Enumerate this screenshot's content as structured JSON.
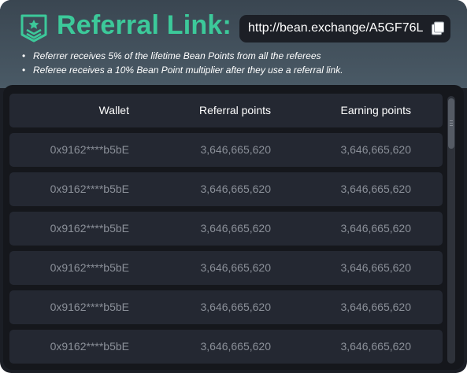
{
  "header": {
    "title": "Referral Link:",
    "link": "http://bean.exchange/A5GF76L",
    "notes": [
      "Referrer receives 5% of the lifetime Bean Points from all the referees",
      "Referee receives a 10% Bean Point multiplier after they use a referral link."
    ]
  },
  "table": {
    "columns": [
      "Wallet",
      "Referral points",
      "Earning  points"
    ],
    "rows": [
      [
        "0x9162****b5bE",
        "3,646,665,620",
        "3,646,665,620"
      ],
      [
        "0x9162****b5bE",
        "3,646,665,620",
        "3,646,665,620"
      ],
      [
        "0x9162****b5bE",
        "3,646,665,620",
        "3,646,665,620"
      ],
      [
        "0x9162****b5bE",
        "3,646,665,620",
        "3,646,665,620"
      ],
      [
        "0x9162****b5bE",
        "3,646,665,620",
        "3,646,665,620"
      ],
      [
        "0x9162****b5bE",
        "3,646,665,620",
        "3,646,665,620"
      ]
    ]
  },
  "icons": {
    "logo": "chevron-badge-icon",
    "copy": "copy-icon"
  },
  "colors": {
    "accent": "#3cc99a",
    "header_bg": "#4a5a66",
    "panel_bg": "#15171c",
    "row_bg": "#242832"
  }
}
